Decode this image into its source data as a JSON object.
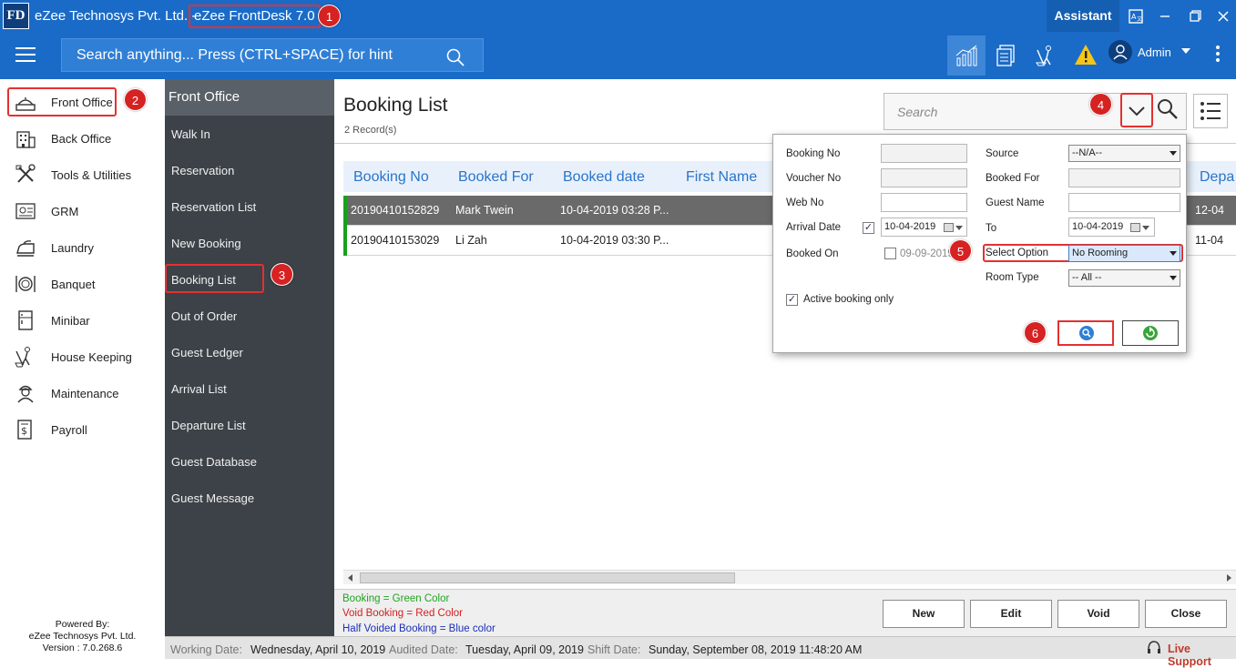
{
  "window": {
    "company": "eZee Technosys Pvt. Ltd. -",
    "app_name": "eZee FrontDesk 7.0",
    "logo": "FD",
    "assistant": "Assistant"
  },
  "toolbar": {
    "search_placeholder": "Search anything... Press (CTRL+SPACE) for hint",
    "user": "Admin"
  },
  "leftnav": {
    "items": [
      {
        "label": "Front Office",
        "icon": "front-desk-icon"
      },
      {
        "label": "Back Office",
        "icon": "building-icon"
      },
      {
        "label": "Tools & Utilities",
        "icon": "tools-icon"
      },
      {
        "label": "GRM",
        "icon": "grm-icon"
      },
      {
        "label": "Laundry",
        "icon": "iron-icon"
      },
      {
        "label": "Banquet",
        "icon": "plate-icon"
      },
      {
        "label": "Minibar",
        "icon": "fridge-icon"
      },
      {
        "label": "House Keeping",
        "icon": "broom-icon"
      },
      {
        "label": "Maintenance",
        "icon": "worker-icon"
      },
      {
        "label": "Payroll",
        "icon": "payroll-icon"
      }
    ],
    "powered_by": "Powered By:",
    "powered_company": "eZee Technosys Pvt. Ltd.",
    "version": "Version : 7.0.268.6"
  },
  "submenu": {
    "title": "Front Office",
    "items": [
      "Walk In",
      "Reservation",
      "Reservation List",
      "New Booking",
      "Booking List",
      "Out of Order",
      "Guest Ledger",
      "Arrival List",
      "Departure List",
      "Guest Database",
      "Guest Message"
    ]
  },
  "content": {
    "title": "Booking List",
    "record_count": "2 Record(s)",
    "search_placeholder": "Search",
    "columns": [
      "Booking No",
      "Booked For",
      "Booked date",
      "First Name",
      "Depa"
    ],
    "rows": [
      {
        "booking_no": "20190410152829",
        "booked_for": "Mark Twein",
        "booked_date": "10-04-2019 03:28 P...",
        "dep": "12-04"
      },
      {
        "booking_no": "20190410153029",
        "booked_for": "Li Zah",
        "booked_date": "10-04-2019 03:30 P...",
        "dep": "11-04"
      }
    ]
  },
  "filter": {
    "booking_no_label": "Booking No",
    "voucher_no_label": "Voucher No",
    "web_no_label": "Web No",
    "arrival_date_label": "Arrival Date",
    "arrival_from": "10-04-2019",
    "booked_on_label": "Booked On",
    "booked_on_value": "09-09-2019",
    "source_label": "Source",
    "source_value": "--N/A--",
    "booked_for_label": "Booked For",
    "guest_name_label": "Guest Name",
    "to_label": "To",
    "arrival_to": "10-04-2019",
    "select_option_label": "Select Option",
    "select_option_value": "No Rooming",
    "room_type_label": "Room Type",
    "room_type_value": "-- All --",
    "active_only_label": "Active booking only"
  },
  "legend": {
    "green": "Booking = Green Color",
    "red": "Void Booking = Red Color",
    "blue": "Half Voided Booking = Blue color"
  },
  "actions": {
    "new": "New",
    "edit": "Edit",
    "void": "Void",
    "close": "Close"
  },
  "status": {
    "working_label": "Working Date:",
    "working_value": "Wednesday, April 10, 2019",
    "audited_label": "Audited Date:",
    "audited_value": "Tuesday, April 09, 2019",
    "shift_label": "Shift Date:",
    "shift_value": "Sunday, September 08, 2019 11:48:20 AM",
    "live_support": "Live Support"
  },
  "annotations": [
    "1",
    "2",
    "3",
    "4",
    "5",
    "6"
  ],
  "colors": {
    "titlebar": "#1a6bc7",
    "submenu": "#3c4248",
    "highlight": "#e53030",
    "booking_green": "#18a01c"
  }
}
